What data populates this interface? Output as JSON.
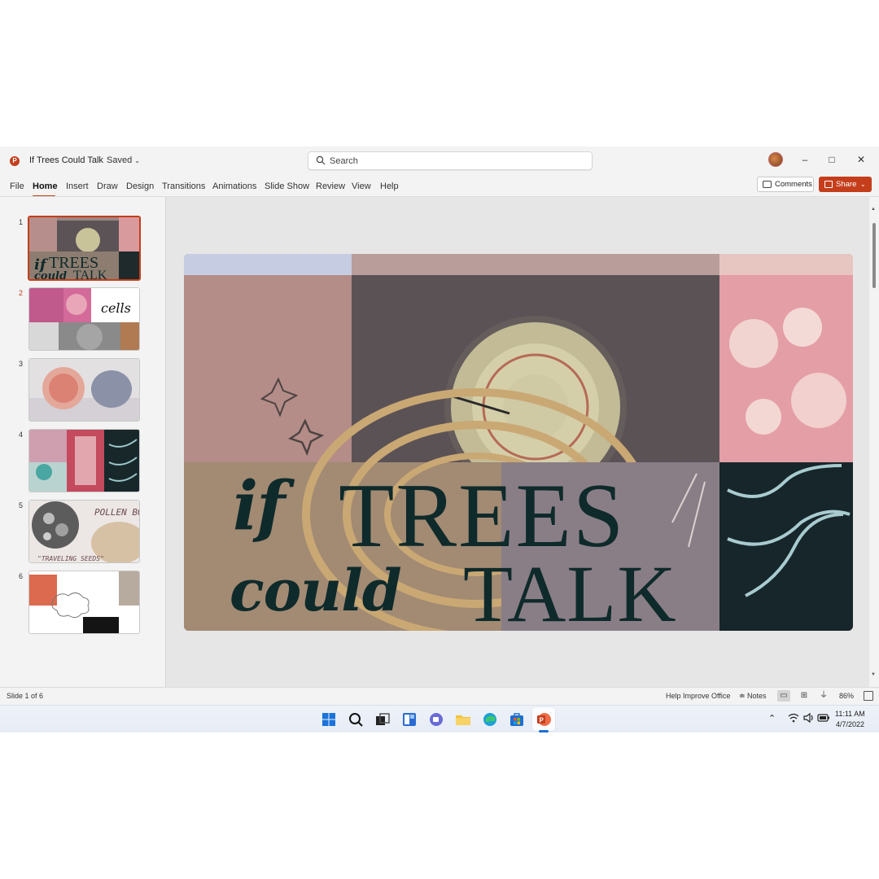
{
  "app": {
    "icon_letter": "P",
    "document_title": "If Trees Could Talk",
    "save_status": "Saved"
  },
  "search": {
    "label": "Search"
  },
  "window_controls": {
    "minimize": "–",
    "maximize": "□",
    "close": "✕"
  },
  "ribbon": {
    "tabs": [
      "File",
      "Home",
      "Insert",
      "Draw",
      "Design",
      "Transitions",
      "Animations",
      "Slide Show",
      "Review",
      "View",
      "Help"
    ],
    "active_tab": "Home",
    "comments_label": "Comments",
    "share_label": "Share"
  },
  "thumbnails": [
    {
      "number": "1",
      "selected": true
    },
    {
      "number": "2",
      "selected": false,
      "text": "cells"
    },
    {
      "number": "3",
      "selected": false
    },
    {
      "number": "4",
      "selected": false
    },
    {
      "number": "5",
      "selected": false,
      "text": "POLLEN BODIES",
      "subtext": "\"TRAVELING SEEDS\""
    },
    {
      "number": "6",
      "selected": false
    }
  ],
  "slide": {
    "title_if": "if",
    "title_trees": "TREES",
    "title_could": "could",
    "title_talk": "TALK"
  },
  "statusbar": {
    "slide_count": "Slide 1 of 6",
    "help": "Help Improve Office",
    "notes": "Notes",
    "zoom": "86%"
  },
  "taskbar": {
    "time": "11:11 AM",
    "date": "4/7/2022"
  },
  "colors": {
    "accent": "#c43e1c",
    "title_text": "#0f2a2b"
  }
}
